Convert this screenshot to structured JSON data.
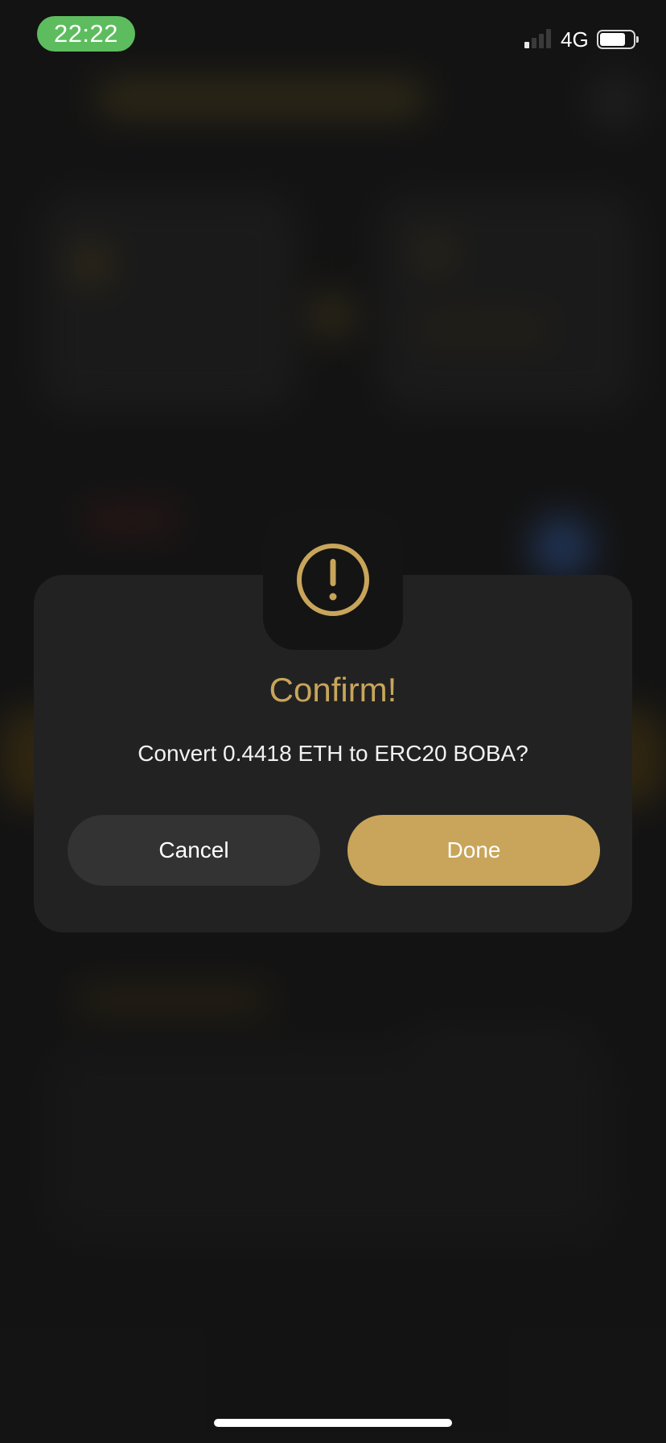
{
  "status_bar": {
    "time": "22:22",
    "network": "4G",
    "signal_bars_active": 1,
    "battery_level": 0.7,
    "time_pill_color": "#5dbd5e"
  },
  "dialog": {
    "icon": "exclamation-circle-icon",
    "title": "Confirm!",
    "message": "Convert 0.4418 ETH to ERC20 BOBA?",
    "cancel_label": "Cancel",
    "done_label": "Done"
  },
  "colors": {
    "accent": "#c8a55a",
    "card_background": "#222222",
    "icon_box_background": "#141414",
    "cancel_button": "#333333",
    "page_background": "#1a1a1a"
  }
}
